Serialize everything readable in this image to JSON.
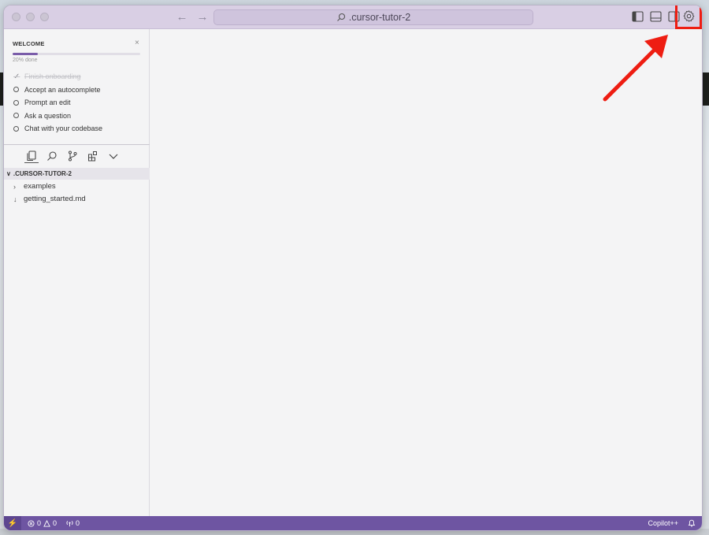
{
  "window": {
    "title": ".cursor-tutor-2"
  },
  "nav": {
    "back": "←",
    "forward": "→"
  },
  "welcome": {
    "header": "WELCOME",
    "close": "×",
    "progress_text": "20% done",
    "progress_value": 0.2,
    "items": [
      {
        "label": "Finish onboarding",
        "done": true
      },
      {
        "label": "Accept an autocomplete",
        "done": false
      },
      {
        "label": "Prompt an edit",
        "done": false
      },
      {
        "label": "Ask a question",
        "done": false
      },
      {
        "label": "Chat with your codebase",
        "done": false
      }
    ]
  },
  "explorer": {
    "folder": ".CURSOR-TUTOR-2",
    "chevron_open": "∨",
    "items": [
      {
        "label": "examples",
        "type": "folder",
        "glyph": "›"
      },
      {
        "label": "getting_started.md",
        "type": "file",
        "glyph": "↓"
      }
    ]
  },
  "statusbar": {
    "remote": "⚡",
    "errors": "0",
    "warnings": "0",
    "ports": "0",
    "copilot": "Copilot++"
  },
  "colors": {
    "accent": "#6e55a2",
    "titlebar": "#d9cfe4",
    "highlight": "#ee1d12"
  }
}
